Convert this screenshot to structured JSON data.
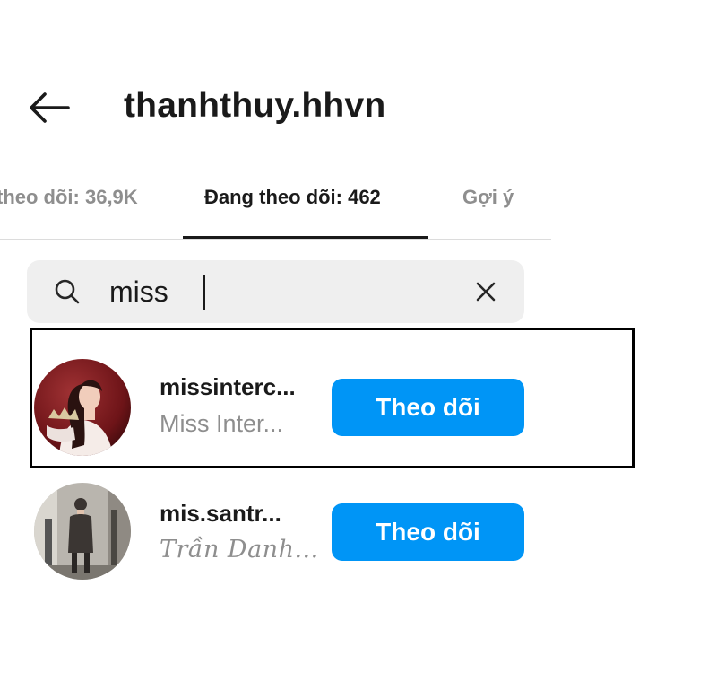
{
  "header": {
    "back_icon": "arrow-left-icon",
    "title": "thanhthuy.hhvn"
  },
  "tabs": [
    {
      "label": "theo dõi: 36,9K",
      "active": false
    },
    {
      "label": "Đang theo dõi: 462",
      "active": true
    },
    {
      "label": "Gợi ý",
      "active": false
    }
  ],
  "search": {
    "icon": "search-icon",
    "value": "miss",
    "clear_icon": "close-icon"
  },
  "results": [
    {
      "username": "missinterc...",
      "full_name": "Miss Inter...",
      "button_label": "Theo dõi",
      "highlighted": true
    },
    {
      "username": "mis.santr...",
      "full_name": "Trần Danh...",
      "button_label": "Theo dõi",
      "highlighted": false
    }
  ],
  "colors": {
    "accent": "#0095f6",
    "muted_text": "#8e8e8e",
    "search_bg": "#efefef"
  }
}
